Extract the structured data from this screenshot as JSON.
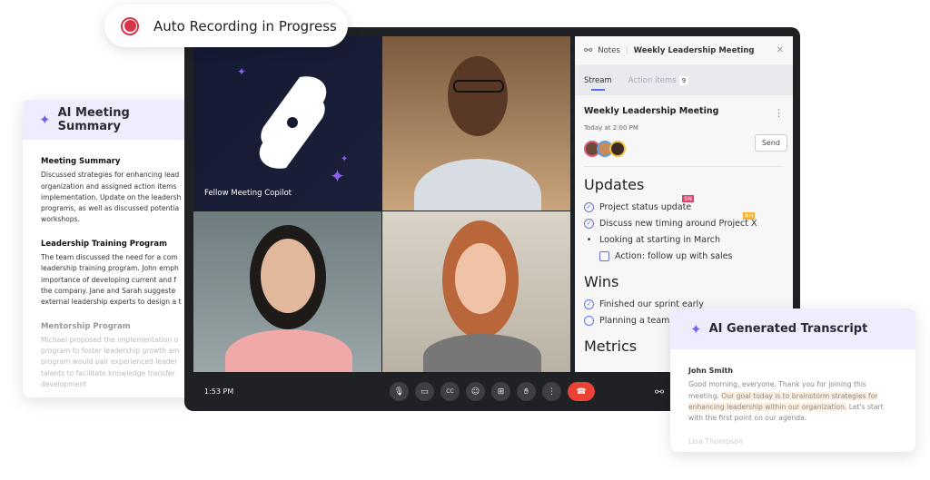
{
  "recording": {
    "label": "Auto Recording in Progress",
    "color": "#d8334a"
  },
  "summary": {
    "title": "AI Meeting Summary",
    "sections": [
      {
        "heading": "Meeting Summary",
        "text": "Discussed strategies for enhancing lead organization and assigned action items implementation. Update on the leadersh programs, as well as discussed potentia workshops."
      },
      {
        "heading": "Leadership Training Program",
        "text": "The team discussed the need for a com leadership training program. John emph importance of developing current and f the company. Jane and Sarah suggeste external leadership experts to design a t"
      },
      {
        "heading": "Mentorship Program",
        "text": "Michael proposed the implementation o program to foster leadership growth am program would pair experienced leader talents to facilitate knowledge transfer development"
      }
    ]
  },
  "video": {
    "copilot_label": "Fellow Meeting Copilot",
    "time": "1:53 PM",
    "controls": [
      "microphone",
      "camera",
      "captions",
      "emoji",
      "present",
      "raise-hand",
      "more",
      "end-call"
    ]
  },
  "notes": {
    "app": "Notes",
    "meeting_title": "Weekly Leadership Meeting",
    "tabs": [
      {
        "label": "Stream",
        "active": true
      },
      {
        "label": "Action items",
        "count": "9"
      }
    ],
    "meeting": {
      "title": "Weekly Leadership Meeting",
      "time": "Today at 2:00 PM",
      "send": "Send"
    },
    "updates": {
      "heading": "Updates",
      "items": [
        "Project status update",
        "Discuss new timing around Project X",
        "Looking at starting in March",
        "Action: follow up with sales"
      ],
      "tags": [
        "SN",
        "RH"
      ]
    },
    "wins": {
      "heading": "Wins",
      "items": [
        "Finished our sprint early",
        "Planning a team lu"
      ]
    },
    "metrics": {
      "heading": "Metrics"
    }
  },
  "transcript": {
    "title": "AI Generated Transcript",
    "speaker1": "John Smith",
    "t1": "Good morning, everyone. Thank you for joining this meeting. ",
    "t2": "Our goal today is to brainstorm strategies for enhancing leadership within our organization.",
    "t3": " Let's start with the first point on our agenda.",
    "speaker2": "Lisa Thompson"
  }
}
